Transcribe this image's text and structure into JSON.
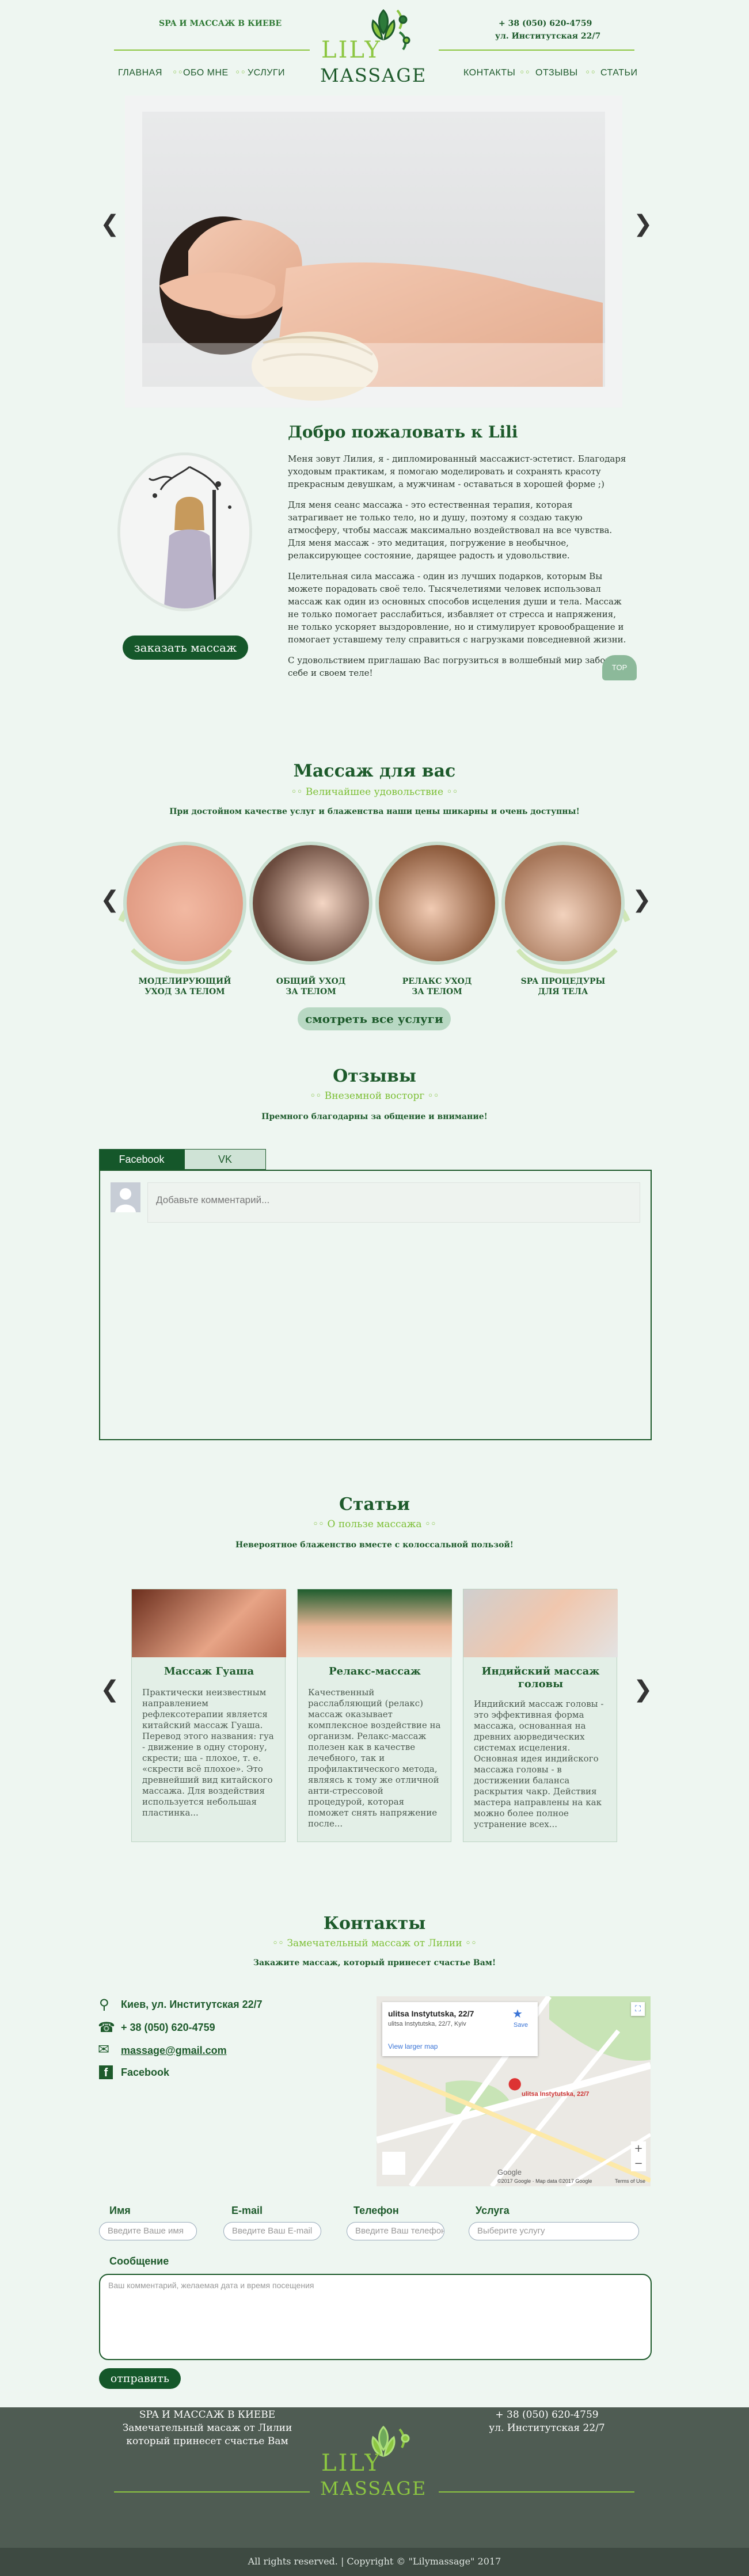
{
  "header": {
    "tagline": "SPA И МАССАЖ В КИЕВЕ",
    "phone": "+ 38 (050) 620-4759",
    "address": "ул. Институтская 22/7",
    "logo_top": "LILY",
    "logo_bottom": "MASSAGE",
    "nav": [
      "ГЛАВНАЯ",
      "ОБО МНЕ",
      "УСЛУГИ",
      "КОНТАКТЫ",
      "ОТЗЫВЫ",
      "СТАТЬИ"
    ]
  },
  "welcome": {
    "title": "Добро пожаловать к Lili",
    "paragraphs": [
      "Меня зовут Лилия, я - дипломированный массажист-эстетист. Благодаря уходовым практикам, я помогаю моделировать и сохранять красоту прекрасным девушкам, а мужчинам - оставаться в хорошей форме ;)",
      "Для меня сеанс массажа - это естественная терапия, которая затрагивает не только тело, но и душу, поэтому я создаю такую атмосферу, чтобы массаж максимально воздействовал на все чувства. Для меня массаж - это медитация, погружение в необычное, релаксирующее состояние, дарящее радость и удовольствие.",
      "Целительная сила массажа - один из лучших подарков, которым Вы можете порадовать своё тело. Тысячелетиями человек использовал массаж как один из основных способов исцеления души и тела. Массаж не только помогает расслабиться, избавляет от стресса и напряжения, не только ускоряет выздоровление, но и стимулирует кровообращение и помогает уставшему телу справиться с нагрузками повседневной жизни.",
      "С удовольствием приглашаю Вас погрузиться в волшебный мир заботы о себе и своем теле!"
    ],
    "order_button": "заказать массаж",
    "top_badge": "TOP"
  },
  "services": {
    "title": "Массаж для вас",
    "subtitle": "Величайшее удовольствие",
    "desc": "При достойном качестве услуг и блаженства наши цены шикарны и очень доступны!",
    "items": [
      {
        "line1": "МОДЕЛИРУЮЩИЙ",
        "line2": "УХОД ЗА ТЕЛОМ"
      },
      {
        "line1": "ОБЩИЙ УХОД",
        "line2": "ЗА ТЕЛОМ"
      },
      {
        "line1": "РЕЛАКС УХОД",
        "line2": "ЗА ТЕЛОМ"
      },
      {
        "line1": "SPA ПРОЦЕДУРЫ",
        "line2": "ДЛЯ ТЕЛА"
      }
    ],
    "all_button": "смотреть все услуги"
  },
  "reviews": {
    "title": "Отзывы",
    "subtitle": "Внеземной восторг",
    "desc": "Премного благодарны за общение и внимание!",
    "tabs": [
      "Facebook",
      "VK"
    ],
    "comment_placeholder": "Добавьте комментарий..."
  },
  "articles": {
    "title": "Статьи",
    "subtitle": "О пользе массажа",
    "desc": "Невероятное блаженство вместе с колоссальной пользой!",
    "items": [
      {
        "title": "Массаж Гуаша",
        "text": "Практически неизвестным направлением рефлексотерапии является китайский массаж Гуаша. Перевод этого названия: гуа - движение в одну сторону, скрести; ша - плохое, т. е. «скрести всё плохое». Это древнейший вид китайского массажа. Для воздействия используется небольшая пластинка..."
      },
      {
        "title": "Релакс-массаж",
        "text": "Качественный расслабляющий (релакс) массаж оказывает комплексное воздействие на организм. Релакс-массаж полезен как в качестве лечебного, так и профилактического метода, являясь к тому же отличной анти-стрессовой процедурой, которая поможет снять напряжение после..."
      },
      {
        "title": "Индийский массаж головы",
        "text": "Индийский массаж головы - это эффективная форма массажа, основанная на древних аюрведических системах исцеления. Основная идея индийского массажа головы - в достижении баланса раскрытия чакр. Действия мастера направлены на как можно более полное устранение всех..."
      }
    ]
  },
  "contacts": {
    "title": "Контакты",
    "subtitle": "Замечательный массаж от Лилии",
    "desc": "Закажите массаж, который принесет счастье Вам!",
    "address": "Киев, ул. Институтская 22/7",
    "phone": "+ 38 (050) 620-4759",
    "email": "massage@gmail.com",
    "facebook": "Facebook",
    "map": {
      "place": "ulitsa Instytutska, 22/7",
      "place_sub": "ulitsa Instytutska, 22/7, Kyiv",
      "save": "Save",
      "larger": "View larger map",
      "pin_label": "ulitsa Instytutska, 22/7",
      "copyright": "©2017 Google · Map data ©2017 Google",
      "terms": "Terms of Use",
      "google": "Google"
    }
  },
  "form": {
    "name_label": "Имя",
    "email_label": "E-mail",
    "phone_label": "Телефон",
    "service_label": "Услуга",
    "name_placeholder": "Введите Ваше имя",
    "email_placeholder": "Введите Ваш E-mail",
    "phone_placeholder": "Введите Ваш телефон",
    "service_placeholder": "Выберите услугу",
    "message_label": "Сообщение",
    "message_placeholder": "Ваш комментарий, желаемая дата и время посещения",
    "submit": "отправить"
  },
  "footer": {
    "left1": "SPA И МАССАЖ В КИЕВЕ",
    "left2": "Замечательный масаж от Лилии",
    "left3": "который принесет счастье Вам",
    "right1": "+ 38 (050) 620-4759",
    "right2": "ул. Институтская 22/7",
    "logo_top": "LILY",
    "logo_bottom": "MASSAGE",
    "copyright": "All rights reserved. | Copyright © \"Lilymassage\" 2017"
  },
  "colors": {
    "background": "#eef6f1",
    "dark_green": "#1d5a2b",
    "light_green": "#7cbf35",
    "footer": "#4f5c53",
    "footer_bottom": "#3e4a42"
  }
}
